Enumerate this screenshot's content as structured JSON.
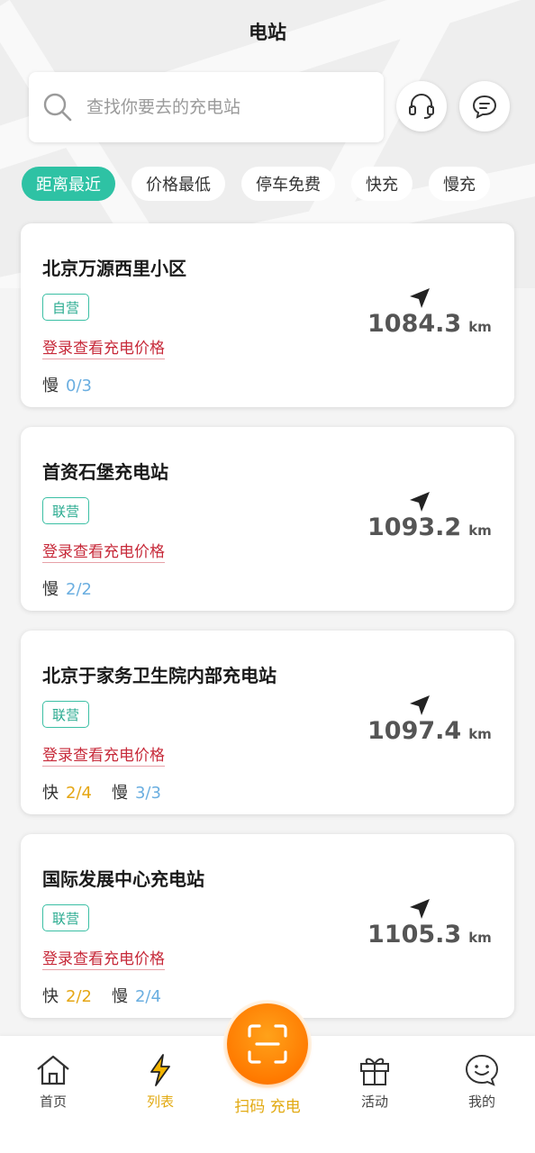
{
  "header": {
    "title": "电站",
    "search_placeholder": "查找你要去的充电站"
  },
  "filters": [
    "距离最近",
    "价格最低",
    "停车免费",
    "快充",
    "慢充"
  ],
  "stations": [
    {
      "name": "北京万源西里小区",
      "tag": "自营",
      "price_link": "登录查看充电价格",
      "fast": null,
      "slow": "0/3",
      "distance": "1084.3",
      "unit": "km"
    },
    {
      "name": "首资石堡充电站",
      "tag": "联营",
      "price_link": "登录查看充电价格",
      "fast": null,
      "slow": "2/2",
      "distance": "1093.2",
      "unit": "km"
    },
    {
      "name": "北京于家务卫生院内部充电站",
      "tag": "联营",
      "price_link": "登录查看充电价格",
      "fast": "2/4",
      "slow": "3/3",
      "distance": "1097.4",
      "unit": "km"
    },
    {
      "name": "国际发展中心充电站",
      "tag": "联营",
      "price_link": "登录查看充电价格",
      "fast": "2/2",
      "slow": "2/4",
      "distance": "1105.3",
      "unit": "km"
    }
  ],
  "port_labels": {
    "fast": "快",
    "slow": "慢"
  },
  "tabbar": {
    "home": "首页",
    "list": "列表",
    "scan": "扫码 充电",
    "activity": "活动",
    "mine": "我的"
  },
  "colors": {
    "accent_green": "#2ec2a4",
    "accent_orange": "#ff8a00",
    "active_tab": "#e2aa12",
    "price_link": "#c72a3a",
    "fast_count": "#e5a614",
    "slow_count": "#6aaee0"
  }
}
